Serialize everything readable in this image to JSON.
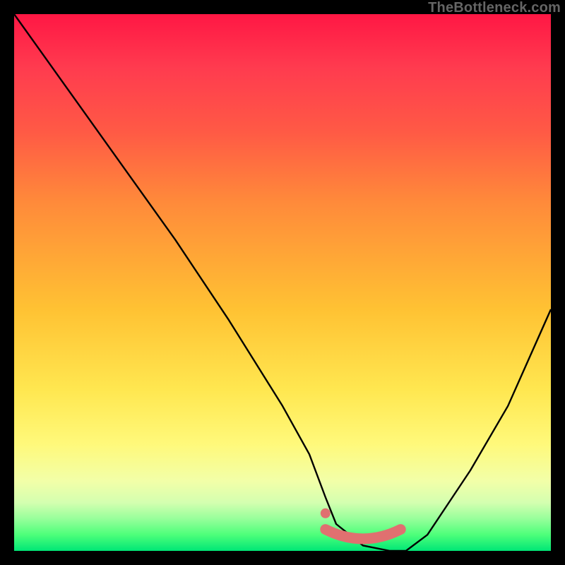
{
  "watermark": "TheBottleneck.com",
  "colors": {
    "curve_stroke": "#000000",
    "marker_stroke": "#e07070",
    "marker_fill": "#e07070",
    "background": "#000000"
  },
  "chart_data": {
    "type": "line",
    "title": "",
    "xlabel": "",
    "ylabel": "",
    "xlim": [
      0,
      100
    ],
    "ylim": [
      0,
      100
    ],
    "grid": false,
    "series": [
      {
        "name": "bottleneck-curve",
        "x": [
          0,
          5,
          10,
          20,
          30,
          40,
          50,
          55,
          58,
          60,
          65,
          70,
          73,
          77,
          85,
          92,
          100
        ],
        "y": [
          100,
          93,
          86,
          72,
          58,
          43,
          27,
          18,
          10,
          5,
          1,
          0,
          0,
          3,
          15,
          27,
          45
        ]
      }
    ],
    "markers": [
      {
        "name": "highlight-band",
        "shape": "wide-dot-band",
        "x_start": 58,
        "x_end": 72,
        "y": 4
      },
      {
        "name": "highlight-dot",
        "shape": "circle",
        "x": 58,
        "y": 7
      }
    ]
  }
}
